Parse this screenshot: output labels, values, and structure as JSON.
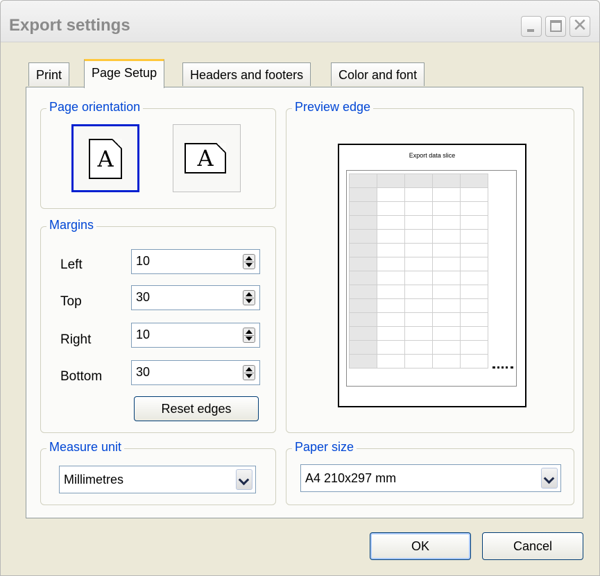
{
  "window": {
    "title": "Export settings",
    "buttons": [
      "minimize",
      "maximize",
      "close"
    ]
  },
  "tabs": [
    {
      "label": "Print",
      "active": false
    },
    {
      "label": "Page Setup",
      "active": true
    },
    {
      "label": "Headers and footers",
      "active": false
    },
    {
      "label": "Color and font",
      "active": false
    }
  ],
  "page_orientation": {
    "label": "Page orientation",
    "options": [
      {
        "name": "portrait",
        "glyph": "A",
        "selected": true
      },
      {
        "name": "landscape",
        "glyph": "A",
        "selected": false
      }
    ]
  },
  "margins": {
    "label": "Margins",
    "fields": [
      {
        "label": "Left",
        "value": "10"
      },
      {
        "label": "Top",
        "value": "30"
      },
      {
        "label": "Right",
        "value": "10"
      },
      {
        "label": "Bottom",
        "value": "30"
      }
    ],
    "reset_label": "Reset edges"
  },
  "preview": {
    "label": "Preview edge",
    "page_title": "Export data slice"
  },
  "measure_unit": {
    "label": "Measure unit",
    "selected": "Millimetres"
  },
  "paper_size": {
    "label": "Paper size",
    "selected": "A4 210x297 mm"
  },
  "footer": {
    "ok_label": "OK",
    "cancel_label": "Cancel"
  },
  "colors": {
    "accent": "#0046d5",
    "selected_border": "#0020d0",
    "tab_highlight": "#ffc83c",
    "dialog_bg": "#ece9d8"
  }
}
